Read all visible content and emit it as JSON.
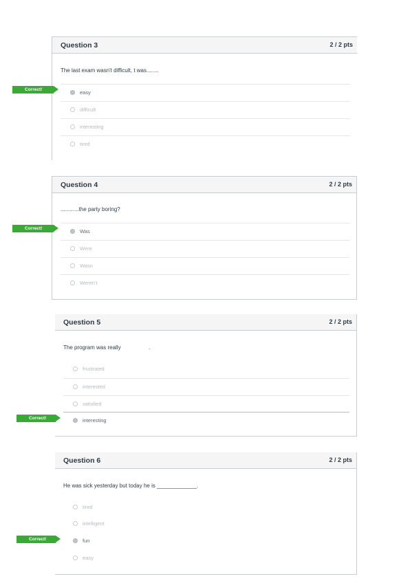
{
  "correct_label": "Correct!",
  "questions": [
    {
      "title": "Question 3",
      "points": "2 / 2 pts",
      "text": "The last exam wasn't difficult, t was........",
      "answers": [
        "easy",
        "difficult",
        "interesting",
        "tired"
      ],
      "selected": 0
    },
    {
      "title": "Question 4",
      "points": "2 / 2 pts",
      "text": "............the party boring?",
      "answers": [
        "Was",
        "Were",
        "Wasn",
        "Weren't"
      ],
      "selected": 0
    },
    {
      "title": "Question 5",
      "points": "2 / 2 pts",
      "text": "The program was really",
      "text_suffix": ".",
      "answers": [
        "frustrated",
        "interested",
        "satisfied",
        "interesting"
      ],
      "selected": 3
    },
    {
      "title": "Question 6",
      "points": "2 / 2 pts",
      "text": "He was sick yesterday but today he is _____________.",
      "answers": [
        "tired",
        "intelligent",
        "fun",
        "easy"
      ],
      "selected": 2
    }
  ]
}
